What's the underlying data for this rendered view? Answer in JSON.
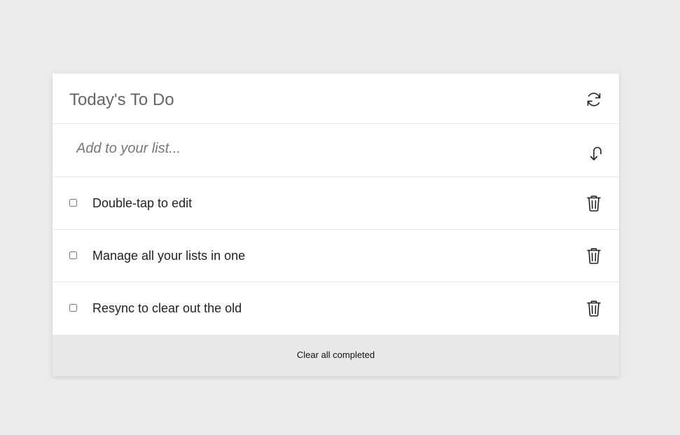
{
  "header": {
    "title": "Today's To Do",
    "sync_icon": "sync-icon"
  },
  "add": {
    "placeholder": "Add to your list...",
    "value": "",
    "submit_icon": "return-arrow-icon"
  },
  "items": [
    {
      "label": "Double-tap to edit",
      "checked": false,
      "delete_icon": "trash-icon"
    },
    {
      "label": "Manage all your lists in one",
      "checked": false,
      "delete_icon": "trash-icon"
    },
    {
      "label": "Resync to clear out the old",
      "checked": false,
      "delete_icon": "trash-icon"
    }
  ],
  "footer": {
    "clear_label": "Clear all completed"
  },
  "colors": {
    "background": "#ebebeb",
    "card": "#ffffff",
    "footer": "#e8e8e8",
    "title": "#666666",
    "text": "#222222"
  }
}
